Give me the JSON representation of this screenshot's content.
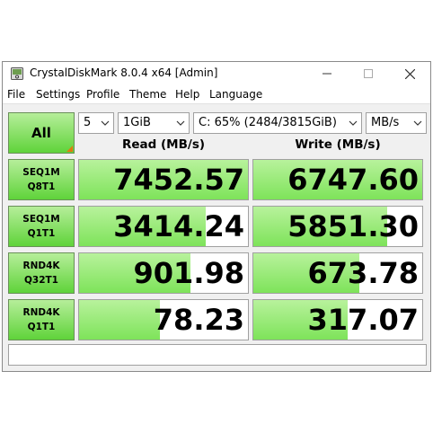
{
  "window": {
    "title": "CrystalDiskMark 8.0.4 x64 [Admin]"
  },
  "menu": [
    "File",
    "Settings",
    "Profile",
    "Theme",
    "Help",
    "Language"
  ],
  "controls": {
    "all_label": "All",
    "count": "5",
    "size": "1GiB",
    "drive": "C: 65% (2484/3815GiB)",
    "unit": "MB/s"
  },
  "headers": {
    "read": "Read (MB/s)",
    "write": "Write (MB/s)"
  },
  "tests": [
    {
      "line1": "SEQ1M",
      "line2": "Q8T1",
      "read": "7452.57",
      "write": "6747.60",
      "read_fill": 1.0,
      "write_fill": 1.0
    },
    {
      "line1": "SEQ1M",
      "line2": "Q1T1",
      "read": "3414.24",
      "write": "5851.30",
      "read_fill": 0.75,
      "write_fill": 0.79
    },
    {
      "line1": "RND4K",
      "line2": "Q32T1",
      "read": "901.98",
      "write": "673.78",
      "read_fill": 0.66,
      "write_fill": 0.63
    },
    {
      "line1": "RND4K",
      "line2": "Q1T1",
      "read": "78.23",
      "write": "317.07",
      "read_fill": 0.48,
      "write_fill": 0.56
    }
  ],
  "comment": ""
}
